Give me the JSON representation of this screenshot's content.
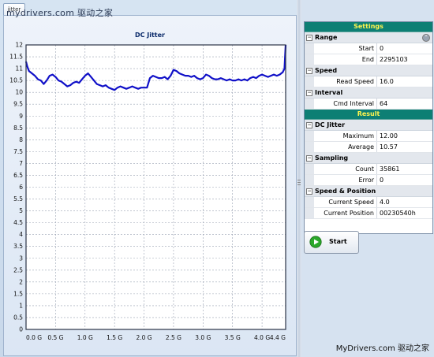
{
  "tab_label": "jitter",
  "watermark_top": "mydrivers.com 驱动之家",
  "watermark_bottom": "MyDrivers.com 驱动之家",
  "chart_data": {
    "type": "line",
    "title": "DC Jitter",
    "xlabel": "",
    "ylabel": "",
    "x_tick_labels": [
      "0.0 G",
      "0.5 G",
      "1.0 G",
      "1.5 G",
      "2.0 G",
      "2.5 G",
      "3.0 G",
      "3.5 G",
      "4.0 G",
      "4.4 G"
    ],
    "x_ticks": [
      0.0,
      0.5,
      1.0,
      1.5,
      2.0,
      2.5,
      3.0,
      3.5,
      4.0,
      4.4
    ],
    "y_tick_labels": [
      "0",
      "0.5",
      "1",
      "1.5",
      "2",
      "2.5",
      "3",
      "3.5",
      "4",
      "4.5",
      "5",
      "5.5",
      "6",
      "6.5",
      "7",
      "7.5",
      "8",
      "8.5",
      "9",
      "9.5",
      "10",
      "10.5",
      "11",
      "11.5",
      "12"
    ],
    "xlim": [
      0,
      4.4
    ],
    "ylim": [
      0,
      12
    ],
    "grid": true,
    "line_color": "#1010c8",
    "series": [
      {
        "x": [
          0.0,
          0.02,
          0.05,
          0.1,
          0.15,
          0.2,
          0.25,
          0.3,
          0.35,
          0.4,
          0.45,
          0.5,
          0.55,
          0.6,
          0.65,
          0.7,
          0.75,
          0.8,
          0.85,
          0.9,
          0.95,
          1.0,
          1.05,
          1.1,
          1.15,
          1.2,
          1.25,
          1.3,
          1.35,
          1.4,
          1.45,
          1.5,
          1.55,
          1.6,
          1.65,
          1.7,
          1.75,
          1.8,
          1.85,
          1.9,
          1.95,
          2.0,
          2.05,
          2.1,
          2.15,
          2.2,
          2.25,
          2.3,
          2.35,
          2.4,
          2.45,
          2.5,
          2.55,
          2.6,
          2.65,
          2.7,
          2.75,
          2.8,
          2.85,
          2.9,
          2.95,
          3.0,
          3.05,
          3.1,
          3.15,
          3.2,
          3.25,
          3.3,
          3.35,
          3.4,
          3.45,
          3.5,
          3.55,
          3.6,
          3.65,
          3.7,
          3.75,
          3.8,
          3.85,
          3.9,
          3.95,
          4.0,
          4.05,
          4.1,
          4.15,
          4.2,
          4.25,
          4.3,
          4.35,
          4.38,
          4.4
        ],
        "y": [
          11.3,
          11.1,
          10.9,
          10.8,
          10.7,
          10.55,
          10.5,
          10.35,
          10.5,
          10.7,
          10.75,
          10.65,
          10.5,
          10.45,
          10.35,
          10.25,
          10.3,
          10.4,
          10.45,
          10.4,
          10.55,
          10.7,
          10.8,
          10.65,
          10.5,
          10.35,
          10.3,
          10.25,
          10.3,
          10.2,
          10.15,
          10.1,
          10.2,
          10.25,
          10.2,
          10.15,
          10.2,
          10.25,
          10.2,
          10.15,
          10.2,
          10.2,
          10.2,
          10.6,
          10.7,
          10.65,
          10.6,
          10.6,
          10.65,
          10.55,
          10.7,
          10.95,
          10.9,
          10.8,
          10.75,
          10.7,
          10.7,
          10.65,
          10.7,
          10.6,
          10.55,
          10.6,
          10.75,
          10.7,
          10.6,
          10.55,
          10.55,
          10.6,
          10.55,
          10.5,
          10.55,
          10.5,
          10.5,
          10.55,
          10.5,
          10.55,
          10.5,
          10.6,
          10.65,
          10.6,
          10.7,
          10.75,
          10.7,
          10.65,
          10.7,
          10.75,
          10.7,
          10.75,
          10.85,
          11.0,
          12.0
        ]
      }
    ]
  },
  "settings": {
    "header": "Settings",
    "range": {
      "label": "Range",
      "start_label": "Start",
      "start_value": "0",
      "end_label": "End",
      "end_value": "2295103"
    },
    "speed": {
      "label": "Speed",
      "read_label": "Read Speed",
      "read_value": "16.0"
    },
    "interval": {
      "label": "Interval",
      "cmd_label": "Cmd Interval",
      "cmd_value": "64"
    }
  },
  "result": {
    "header": "Result",
    "dc_jitter": {
      "label": "DC Jitter",
      "max_label": "Maximum",
      "max_value": "12.00",
      "avg_label": "Average",
      "avg_value": "10.57"
    },
    "sampling": {
      "label": "Sampling",
      "count_label": "Count",
      "count_value": "35861",
      "error_label": "Error",
      "error_value": "0"
    },
    "speed_position": {
      "label": "Speed & Position",
      "speed_label": "Current Speed",
      "speed_value": "4.0",
      "pos_label": "Current Position",
      "pos_value": "00230540h"
    }
  },
  "start_button": {
    "label": "Start",
    "icon": "play-icon",
    "icon_color": "#2aa82a"
  },
  "colors": {
    "header_bg": "#0d7f74",
    "header_text": "#fff44f"
  }
}
